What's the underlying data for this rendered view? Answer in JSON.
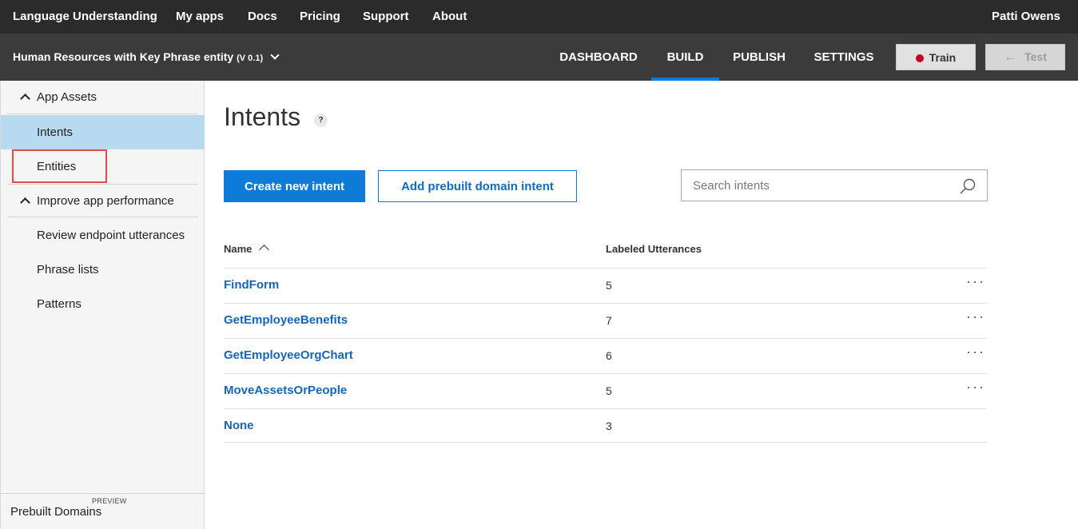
{
  "topnav": {
    "brand": "Language Understanding",
    "links": [
      "My apps",
      "Docs",
      "Pricing",
      "Support",
      "About"
    ],
    "user": "Patti Owens"
  },
  "appbar": {
    "app_name": "Human Resources with Key Phrase entity",
    "version": "(V 0.1)",
    "tabs": [
      "DASHBOARD",
      "BUILD",
      "PUBLISH",
      "SETTINGS"
    ],
    "active_tab": "BUILD",
    "train_label": "Train",
    "test_label": "Test",
    "train_status_color": "#c4001e",
    "accent_color": "#0f7bd8"
  },
  "sidebar": {
    "section1": "App Assets",
    "items1": [
      "Intents",
      "Entities"
    ],
    "section2": "Improve app performance",
    "items2": [
      "Review endpoint utterances",
      "Phrase lists",
      "Patterns"
    ],
    "prebuilt_label": "Prebuilt Domains",
    "prebuilt_tag": "PREVIEW"
  },
  "main": {
    "title": "Intents",
    "help_icon": "?",
    "create_button": "Create new intent",
    "add_prebuilt_button": "Add prebuilt domain intent",
    "search_placeholder": "Search intents",
    "col_name": "Name",
    "col_utterances": "Labeled Utterances",
    "rows": [
      {
        "name": "FindForm",
        "count": "5"
      },
      {
        "name": "GetEmployeeBenefits",
        "count": "7"
      },
      {
        "name": "GetEmployeeOrgChart",
        "count": "6"
      },
      {
        "name": "MoveAssetsOrPeople",
        "count": "5"
      },
      {
        "name": "None",
        "count": "3"
      }
    ],
    "more_glyph": "···"
  }
}
